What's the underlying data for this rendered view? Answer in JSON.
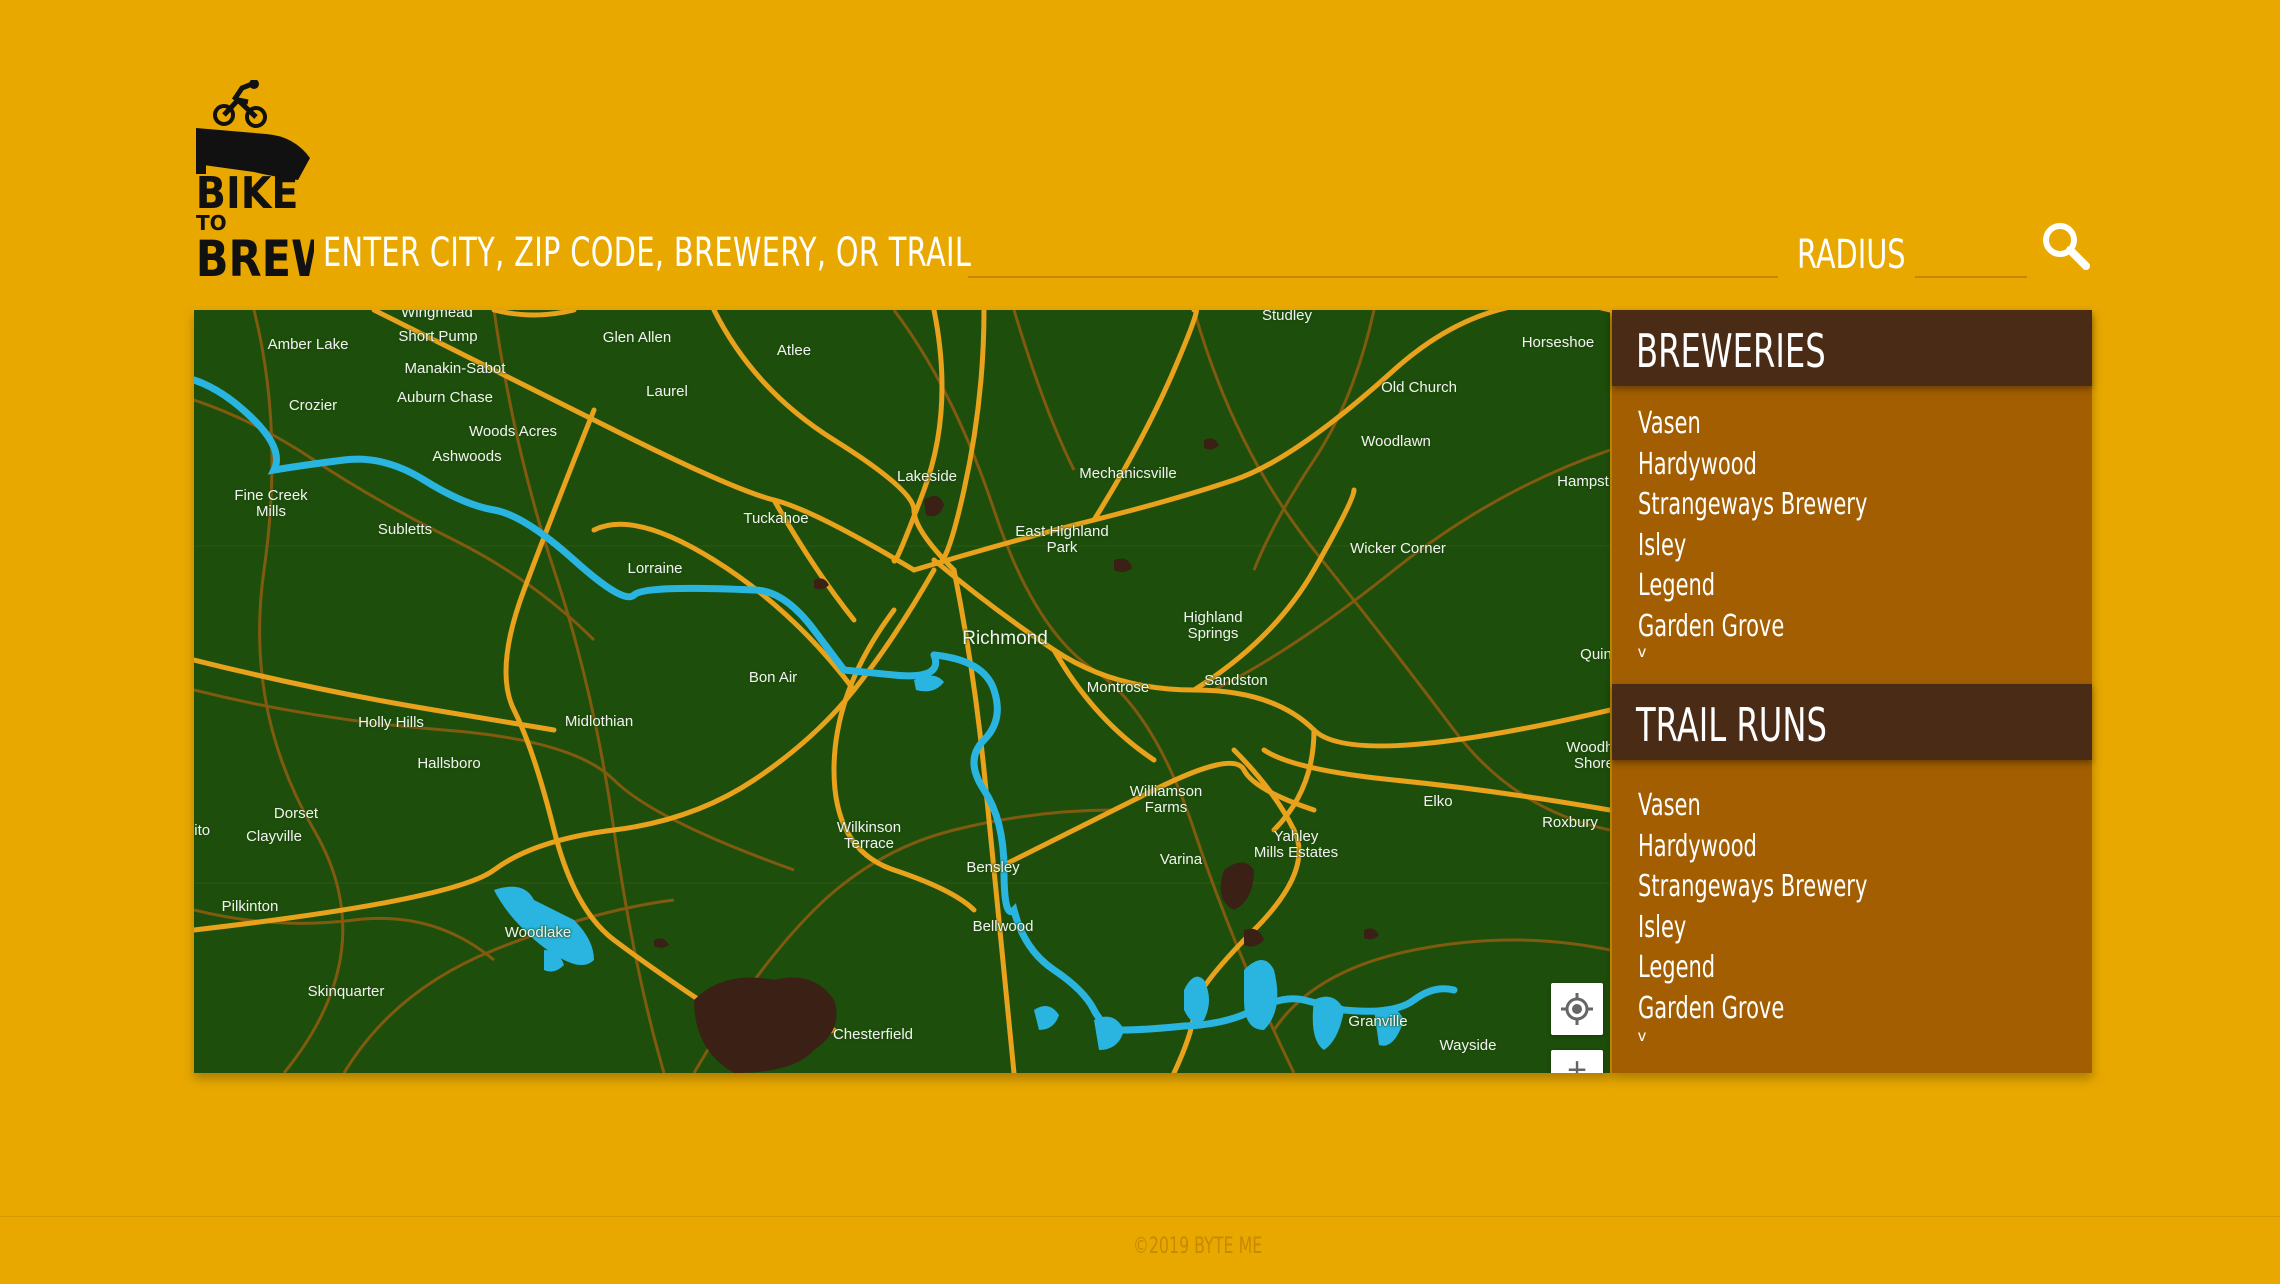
{
  "colors": {
    "background": "#E8A800",
    "map_land": "#1E4E0C",
    "map_roads": "#E8A21C",
    "map_water": "#29B5E0",
    "panel": "#A25E00",
    "panel_header": "#4A2B16",
    "text": "#FFFFFF"
  },
  "header": {
    "logo_text": "BIKE TO BREW",
    "search_label": "ENTER CITY, ZIP CODE, BREWERY, OR TRAIL",
    "search_value": "",
    "radius_label": "RADIUS",
    "radius_value": "",
    "search_icon": "search-icon"
  },
  "map": {
    "labels": [
      {
        "text": "Wingmead",
        "kind": "town"
      },
      {
        "text": "Amber Lake",
        "kind": "town"
      },
      {
        "text": "Short Pump",
        "kind": "town"
      },
      {
        "text": "Glen Allen",
        "kind": "town"
      },
      {
        "text": "Atlee",
        "kind": "town"
      },
      {
        "text": "Studley",
        "kind": "town"
      },
      {
        "text": "Horseshoe",
        "kind": "town"
      },
      {
        "text": "Manakin-Sabot",
        "kind": "town"
      },
      {
        "text": "Crozier",
        "kind": "town"
      },
      {
        "text": "Auburn Chase",
        "kind": "town"
      },
      {
        "text": "Laurel",
        "kind": "town"
      },
      {
        "text": "Old Church",
        "kind": "town"
      },
      {
        "text": "Woods Acres",
        "kind": "town"
      },
      {
        "text": "Ashwoods",
        "kind": "town"
      },
      {
        "text": "Woodlawn",
        "kind": "town"
      },
      {
        "text": "Lakeside",
        "kind": "town"
      },
      {
        "text": "Mechanicsville",
        "kind": "town"
      },
      {
        "text": "Hampst",
        "kind": "town"
      },
      {
        "text": "Fine Creek\nMills",
        "kind": "town"
      },
      {
        "text": "Tuckahoe",
        "kind": "town"
      },
      {
        "text": "Subletts",
        "kind": "town"
      },
      {
        "text": "East Highland\nPark",
        "kind": "town"
      },
      {
        "text": "Wicker Corner",
        "kind": "town"
      },
      {
        "text": "Lorraine",
        "kind": "town"
      },
      {
        "text": "Highland\nSprings",
        "kind": "town"
      },
      {
        "text": "Richmond",
        "kind": "city"
      },
      {
        "text": "Quin",
        "kind": "town"
      },
      {
        "text": "Bon Air",
        "kind": "town"
      },
      {
        "text": "Montrose",
        "kind": "town"
      },
      {
        "text": "Sandston",
        "kind": "town"
      },
      {
        "text": "Holly Hills",
        "kind": "town"
      },
      {
        "text": "Midlothian",
        "kind": "town"
      },
      {
        "text": "Woodha\nShore",
        "kind": "town"
      },
      {
        "text": "Hallsboro",
        "kind": "town"
      },
      {
        "text": "Williamson\nFarms",
        "kind": "town"
      },
      {
        "text": "Elko",
        "kind": "town"
      },
      {
        "text": "Dorset",
        "kind": "town"
      },
      {
        "text": "Roxbury",
        "kind": "town"
      },
      {
        "text": "hito",
        "kind": "town"
      },
      {
        "text": "Clayville",
        "kind": "town"
      },
      {
        "text": "Wilkinson\nTerrace",
        "kind": "town"
      },
      {
        "text": "Yahley\nMills Estates",
        "kind": "town"
      },
      {
        "text": "Varina",
        "kind": "town"
      },
      {
        "text": "Bensley",
        "kind": "town"
      },
      {
        "text": "Pilkinton",
        "kind": "town"
      },
      {
        "text": "Woodlake",
        "kind": "town"
      },
      {
        "text": "Bellwood",
        "kind": "town"
      },
      {
        "text": "Skinquarter",
        "kind": "town"
      },
      {
        "text": "Granville",
        "kind": "town"
      },
      {
        "text": "Chesterfield",
        "kind": "town"
      },
      {
        "text": "Wayside",
        "kind": "town"
      }
    ],
    "controls": {
      "locate_icon": "crosshair-icon",
      "zoom_in_label": "+"
    }
  },
  "panel": {
    "breweries": {
      "title": "BREWERIES",
      "items": [
        "Vasen",
        "Hardywood",
        "Strangeways Brewery",
        "Isley",
        "Legend",
        "Garden Grove"
      ],
      "more": "v"
    },
    "trail_runs": {
      "title": "TRAIL RUNS",
      "items": [
        "Vasen",
        "Hardywood",
        "Strangeways Brewery",
        "Isley",
        "Legend",
        "Garden Grove"
      ],
      "more": "v"
    }
  },
  "footer": {
    "copyright": "©2019 BYTE ME"
  }
}
